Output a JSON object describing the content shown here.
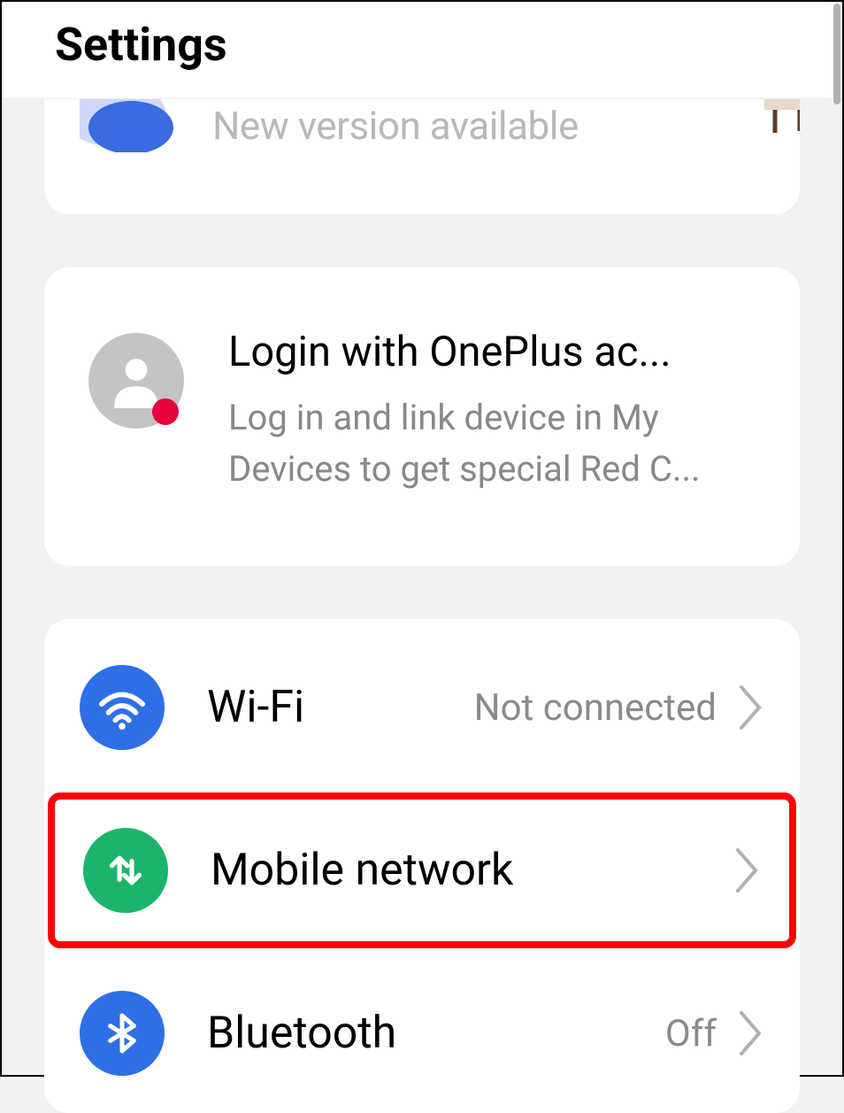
{
  "header": {
    "title": "Settings"
  },
  "update_banner": {
    "text": "New version available"
  },
  "account": {
    "title": "Login with OnePlus ac...",
    "subtitle": "Log in and link device in My Devices to get special Red C..."
  },
  "items": [
    {
      "label": "Wi-Fi",
      "value": "Not connected",
      "icon": "wifi-icon",
      "highlighted": false
    },
    {
      "label": "Mobile network",
      "value": "",
      "icon": "mobile-data-icon",
      "highlighted": true
    },
    {
      "label": "Bluetooth",
      "value": "Off",
      "icon": "bluetooth-icon",
      "highlighted": false
    }
  ],
  "colors": {
    "highlight": "#ff0000",
    "wifi_bg": "#2e6fe8",
    "mobile_bg": "#1ab56a",
    "bluetooth_bg": "#2e6fe8"
  }
}
